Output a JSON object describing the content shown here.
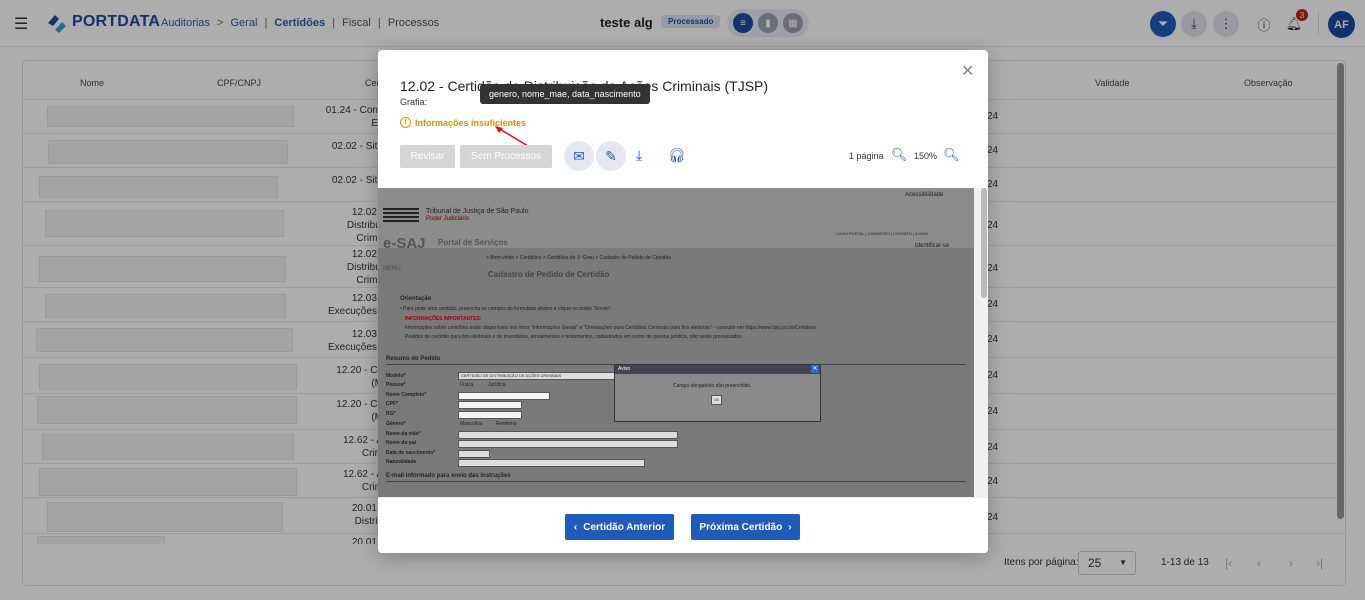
{
  "topbar": {
    "brand": "PORTDATA",
    "breadcrumbs": [
      "Auditorias",
      "Geral",
      "Certidões",
      "Fiscal",
      "Processos"
    ],
    "breadcrumb_separators": [
      ">",
      "|",
      "|",
      "|"
    ],
    "project_name": "teste alg",
    "project_status": "Processado",
    "notification_count": "3",
    "user_initials": "AF"
  },
  "table": {
    "headers": [
      "Nome",
      "CPF/CNPJ",
      "Cer",
      "Validade",
      "Observação"
    ],
    "rows": [
      {
        "cert": "01.24 - Cons",
        "cert2": "Es",
        "date": "24"
      },
      {
        "cert": "02.02 - Situ",
        "cert2": "",
        "date": "24"
      },
      {
        "cert": "02.02 - Situ",
        "cert2": "",
        "date": "24"
      },
      {
        "cert": "12.02 -",
        "cert2": "Distribui",
        "cert3": "Crimir",
        "date": "24"
      },
      {
        "cert": "12.02 -",
        "cert2": "Distribui",
        "cert3": "Crimir",
        "date": "24"
      },
      {
        "cert": "12.03 -",
        "cert2": "Execuções (",
        "date": "24"
      },
      {
        "cert": "12.03 -",
        "cert2": "Execuções (",
        "date": "24"
      },
      {
        "cert": "12.20 - Ce",
        "cert2": "(M",
        "date": "24"
      },
      {
        "cert": "12.20 - Ce",
        "cert2": "(M",
        "date": "24"
      },
      {
        "cert": "12.62 - A",
        "cert2": "Crim",
        "date": "24"
      },
      {
        "cert": "12.62 - A",
        "cert2": "Crim",
        "date": "24"
      },
      {
        "cert": "20.01 -",
        "cert2": "Distrib",
        "date": "24"
      },
      {
        "cert": "20.01 -",
        "cert2": "",
        "date": ""
      }
    ],
    "pagination": {
      "items_per_page_label": "Itens por página:",
      "items_per_page": "25",
      "range": "1-13 de 13"
    }
  },
  "modal": {
    "title": "12.02 - Certidão de Distribuição de Ações Criminais (TJSP)",
    "subtitle": "Grafia:",
    "tooltip": "genero, nome_mae, data_nascimento",
    "warning": "Informações insuficientes",
    "btn_revisar": "Revisar",
    "btn_sem_processos": "Sem Processos",
    "pages": "1 página",
    "zoom": "150%",
    "btn_prev": "Certidão Anterior",
    "btn_next": "Próxima Certidão"
  },
  "document": {
    "accessibility": "Acessibilidade",
    "tribunal": "Tribunal de Justiça de São Paulo",
    "poder": "Poder Judiciário",
    "portal": "e-SAJ",
    "portal_sub": "Portal de Serviços",
    "nav_links": "CAIXA POSTAL   |   CADASTRO   |   CONTATO   |   AJUDA",
    "identify": "Identificar-se",
    "menu": "MENU",
    "breadcrumb": "> Bem-vindo > Certidões > Certidões de 1º Grau > Cadastro de Pedido de Certidão",
    "page_title": "Cadastro de Pedido de Certidão",
    "orientacao": "Orientação",
    "orient_line1": "• Para pedir uma certidão, preencha os campos do formulário abaixo e clique no botão \"Enviar\".",
    "important": "INFORMAÇÕES IMPORTANTES:",
    "info1": "Informações sobre certidões estão disponíveis nos itens \"Informações Gerais\" e \"Orientações para Certidões Criminais para fins eleitorais\" - consulte em https://www.tjsp.jus.br/Certidoes",
    "info2": "Pedidos de certidão para fins eleitorais e de inventários, arrolamentos e testamentos, cadastrados em nome de pessoa jurídica, não serão processados.",
    "resumo": "Resumo do Pedido",
    "fields": [
      "Modelo*",
      "Pessoa*",
      "Nome Completo*",
      "CPF*",
      "RG*",
      "Gênero*",
      "Nome da mãe*",
      "Nome do pai",
      "Data de nascimento*",
      "Naturalidade"
    ],
    "modelo_value": "CERTIDÃO DE DISTRIBUIÇÃO DE AÇÕES CRIMINAIS",
    "pessoa_options": [
      "Física",
      "Jurídica"
    ],
    "genero_options": [
      "Masculino",
      "Feminino"
    ],
    "email_section": "E-mail informado para envio das instruções",
    "alert_title": "Aviso",
    "alert_message": "Campo obrigatório não preenchido.",
    "alert_ok": "Ok"
  }
}
